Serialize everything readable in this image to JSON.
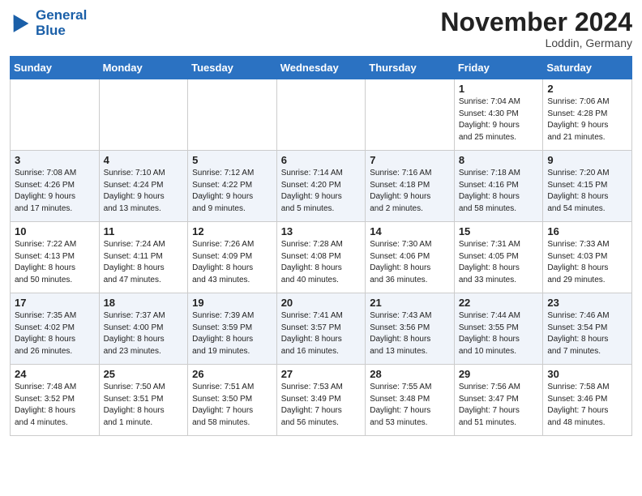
{
  "header": {
    "logo_line1": "General",
    "logo_line2": "Blue",
    "month_title": "November 2024",
    "location": "Loddin, Germany"
  },
  "weekdays": [
    "Sunday",
    "Monday",
    "Tuesday",
    "Wednesday",
    "Thursday",
    "Friday",
    "Saturday"
  ],
  "weeks": [
    [
      {
        "day": "",
        "info": ""
      },
      {
        "day": "",
        "info": ""
      },
      {
        "day": "",
        "info": ""
      },
      {
        "day": "",
        "info": ""
      },
      {
        "day": "",
        "info": ""
      },
      {
        "day": "1",
        "info": "Sunrise: 7:04 AM\nSunset: 4:30 PM\nDaylight: 9 hours\nand 25 minutes."
      },
      {
        "day": "2",
        "info": "Sunrise: 7:06 AM\nSunset: 4:28 PM\nDaylight: 9 hours\nand 21 minutes."
      }
    ],
    [
      {
        "day": "3",
        "info": "Sunrise: 7:08 AM\nSunset: 4:26 PM\nDaylight: 9 hours\nand 17 minutes."
      },
      {
        "day": "4",
        "info": "Sunrise: 7:10 AM\nSunset: 4:24 PM\nDaylight: 9 hours\nand 13 minutes."
      },
      {
        "day": "5",
        "info": "Sunrise: 7:12 AM\nSunset: 4:22 PM\nDaylight: 9 hours\nand 9 minutes."
      },
      {
        "day": "6",
        "info": "Sunrise: 7:14 AM\nSunset: 4:20 PM\nDaylight: 9 hours\nand 5 minutes."
      },
      {
        "day": "7",
        "info": "Sunrise: 7:16 AM\nSunset: 4:18 PM\nDaylight: 9 hours\nand 2 minutes."
      },
      {
        "day": "8",
        "info": "Sunrise: 7:18 AM\nSunset: 4:16 PM\nDaylight: 8 hours\nand 58 minutes."
      },
      {
        "day": "9",
        "info": "Sunrise: 7:20 AM\nSunset: 4:15 PM\nDaylight: 8 hours\nand 54 minutes."
      }
    ],
    [
      {
        "day": "10",
        "info": "Sunrise: 7:22 AM\nSunset: 4:13 PM\nDaylight: 8 hours\nand 50 minutes."
      },
      {
        "day": "11",
        "info": "Sunrise: 7:24 AM\nSunset: 4:11 PM\nDaylight: 8 hours\nand 47 minutes."
      },
      {
        "day": "12",
        "info": "Sunrise: 7:26 AM\nSunset: 4:09 PM\nDaylight: 8 hours\nand 43 minutes."
      },
      {
        "day": "13",
        "info": "Sunrise: 7:28 AM\nSunset: 4:08 PM\nDaylight: 8 hours\nand 40 minutes."
      },
      {
        "day": "14",
        "info": "Sunrise: 7:30 AM\nSunset: 4:06 PM\nDaylight: 8 hours\nand 36 minutes."
      },
      {
        "day": "15",
        "info": "Sunrise: 7:31 AM\nSunset: 4:05 PM\nDaylight: 8 hours\nand 33 minutes."
      },
      {
        "day": "16",
        "info": "Sunrise: 7:33 AM\nSunset: 4:03 PM\nDaylight: 8 hours\nand 29 minutes."
      }
    ],
    [
      {
        "day": "17",
        "info": "Sunrise: 7:35 AM\nSunset: 4:02 PM\nDaylight: 8 hours\nand 26 minutes."
      },
      {
        "day": "18",
        "info": "Sunrise: 7:37 AM\nSunset: 4:00 PM\nDaylight: 8 hours\nand 23 minutes."
      },
      {
        "day": "19",
        "info": "Sunrise: 7:39 AM\nSunset: 3:59 PM\nDaylight: 8 hours\nand 19 minutes."
      },
      {
        "day": "20",
        "info": "Sunrise: 7:41 AM\nSunset: 3:57 PM\nDaylight: 8 hours\nand 16 minutes."
      },
      {
        "day": "21",
        "info": "Sunrise: 7:43 AM\nSunset: 3:56 PM\nDaylight: 8 hours\nand 13 minutes."
      },
      {
        "day": "22",
        "info": "Sunrise: 7:44 AM\nSunset: 3:55 PM\nDaylight: 8 hours\nand 10 minutes."
      },
      {
        "day": "23",
        "info": "Sunrise: 7:46 AM\nSunset: 3:54 PM\nDaylight: 8 hours\nand 7 minutes."
      }
    ],
    [
      {
        "day": "24",
        "info": "Sunrise: 7:48 AM\nSunset: 3:52 PM\nDaylight: 8 hours\nand 4 minutes."
      },
      {
        "day": "25",
        "info": "Sunrise: 7:50 AM\nSunset: 3:51 PM\nDaylight: 8 hours\nand 1 minute."
      },
      {
        "day": "26",
        "info": "Sunrise: 7:51 AM\nSunset: 3:50 PM\nDaylight: 7 hours\nand 58 minutes."
      },
      {
        "day": "27",
        "info": "Sunrise: 7:53 AM\nSunset: 3:49 PM\nDaylight: 7 hours\nand 56 minutes."
      },
      {
        "day": "28",
        "info": "Sunrise: 7:55 AM\nSunset: 3:48 PM\nDaylight: 7 hours\nand 53 minutes."
      },
      {
        "day": "29",
        "info": "Sunrise: 7:56 AM\nSunset: 3:47 PM\nDaylight: 7 hours\nand 51 minutes."
      },
      {
        "day": "30",
        "info": "Sunrise: 7:58 AM\nSunset: 3:46 PM\nDaylight: 7 hours\nand 48 minutes."
      }
    ]
  ]
}
